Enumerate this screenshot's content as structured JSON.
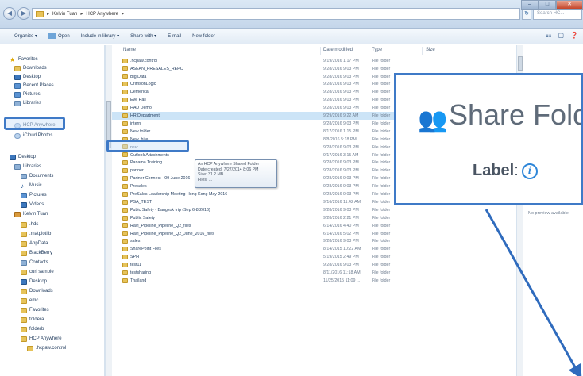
{
  "window": {
    "breadcrumb": [
      "Kelvin Tuan",
      "HCP Anywhere"
    ],
    "search_placeholder": "Search HC..."
  },
  "toolbar": {
    "organize": "Organize ▾",
    "open": "Open",
    "include": "Include in library ▾",
    "share": "Share with ▾",
    "email": "E-mail",
    "newfolder": "New folder"
  },
  "nav": {
    "favorites": "Favorites",
    "downloads": "Downloads",
    "desktop": "Desktop",
    "recent": "Recent Places",
    "pictures": "Pictures",
    "libraries": "Libraries",
    "hcp": "HCP Anywhere",
    "icloud": "iCloud Photos",
    "desktop2": "Desktop",
    "libraries2": "Libraries",
    "documents": "Documents",
    "music": "Music",
    "pictures2": "Pictures",
    "videos": "Videos",
    "kelvin": "Kelvin Tuan",
    "sub": [
      ".hds",
      ".matplotlib",
      "AppData",
      "BlackBerry",
      "Contacts",
      "curl sample",
      "Desktop",
      "Downloads",
      "emc",
      "Favorites",
      "foldera",
      "folderb",
      "HCP Anywhere",
      ".hcpaw.control"
    ]
  },
  "columns": {
    "name": "Name",
    "date": "Date modified",
    "type": "Type",
    "size": "Size"
  },
  "files": [
    {
      "name": ".hcpaw.control",
      "date": "9/19/2016 1:17 PM",
      "type": "File folder"
    },
    {
      "name": "ASEAN_PRESALES_REPO",
      "date": "9/28/2016 9:03 PM",
      "type": "File folder"
    },
    {
      "name": "Big Data",
      "date": "9/28/2016 9:03 PM",
      "type": "File folder"
    },
    {
      "name": "CrimsonLogic",
      "date": "9/28/2016 9:03 PM",
      "type": "File folder"
    },
    {
      "name": "Demerica",
      "date": "9/28/2016 9:03 PM",
      "type": "File folder"
    },
    {
      "name": "Eve Rail",
      "date": "9/28/2016 9:03 PM",
      "type": "File folder"
    },
    {
      "name": "HAD Demo",
      "date": "9/28/2016 9:03 PM",
      "type": "File folder"
    },
    {
      "name": "HR Department",
      "date": "9/29/2016 9:22 AM",
      "type": "File folder"
    },
    {
      "name": "intern",
      "date": "9/28/2016 9:03 PM",
      "type": "File folder"
    },
    {
      "name": "New folder",
      "date": "8/17/2016 1:15 PM",
      "type": "File folder"
    },
    {
      "name": "New_hire",
      "date": "8/8/2016 5:18 PM",
      "type": "File folder"
    },
    {
      "name": "ntuc",
      "date": "9/28/2016 9:03 PM",
      "type": "File folder"
    },
    {
      "name": "Outlook Attachments",
      "date": "9/17/2016 3:15 AM",
      "type": "File folder"
    },
    {
      "name": "Panama Training",
      "date": "9/28/2016 9:03 PM",
      "type": "File folder"
    },
    {
      "name": "partner",
      "date": "9/28/2016 9:03 PM",
      "type": "File folder"
    },
    {
      "name": "Partner Connect - 09 June 2016",
      "date": "9/28/2016 9:03 PM",
      "type": "File folder"
    },
    {
      "name": "Presales",
      "date": "9/28/2016 9:03 PM",
      "type": "File folder"
    },
    {
      "name": "PreSales Leadership Meeting Hong Kong May 2016",
      "date": "9/28/2016 9:03 PM",
      "type": "File folder"
    },
    {
      "name": "PSA_TEST",
      "date": "9/16/2016 11:42 AM",
      "type": "File folder"
    },
    {
      "name": "Pubic Safety - Bangkok trip (Sep 6-8,2016)",
      "date": "9/28/2016 9:03 PM",
      "type": "File folder"
    },
    {
      "name": "Public Safety",
      "date": "9/28/2016 2:21 PM",
      "type": "File folder"
    },
    {
      "name": "Ravi_Pipeline_Pipeline_Q2_files",
      "date": "6/14/2016 4:40 PM",
      "type": "File folder"
    },
    {
      "name": "Ravi_Pipeline_Pipeline_Q2_June_2016_files",
      "date": "6/14/2016 5:02 PM",
      "type": "File folder"
    },
    {
      "name": "sales",
      "date": "9/28/2016 9:03 PM",
      "type": "File folder"
    },
    {
      "name": "SharePoint Files",
      "date": "8/14/2015 10:22 AM",
      "type": "File folder"
    },
    {
      "name": "SPH",
      "date": "5/19/2015 2:49 PM",
      "type": "File folder"
    },
    {
      "name": "test11",
      "date": "9/28/2016 9:03 PM",
      "type": "File folder"
    },
    {
      "name": "testsharing",
      "date": "8/11/2016 11:18 AM",
      "type": "File folder"
    },
    {
      "name": "Thailand",
      "date": "11/25/2015 11:09 ...",
      "type": "File folder"
    }
  ],
  "tooltip": {
    "line1": "An HCP Anywhere Shared Folder",
    "line2": "Date created: 7/27/2014 8:06 PM",
    "line3": "Size: 31.2 MB",
    "line4": "Files: ..."
  },
  "preview": {
    "message": "No preview available."
  },
  "callout": {
    "title": "Share Folder",
    "label": "Label",
    "colon": ":",
    "info": "i"
  },
  "colors": {
    "highlight": "#3f7ac7",
    "arrow": "#2f6bbd"
  }
}
